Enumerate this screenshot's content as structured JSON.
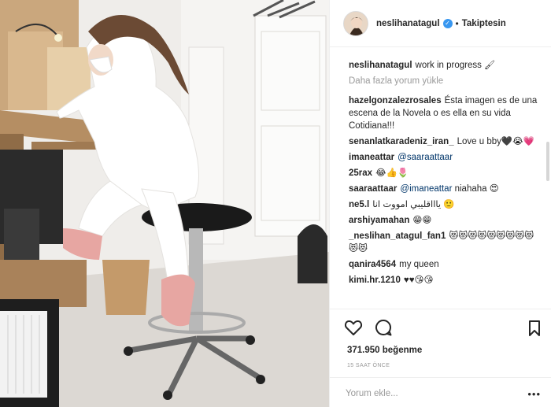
{
  "post": {
    "username": "neslihanatagul",
    "follow_status": "Takiptesin",
    "separator": "•",
    "verified_symbol": "✓"
  },
  "caption": {
    "username": "neslihanatagul",
    "text": "work in progress",
    "emoji": "🖌"
  },
  "load_more": "Daha fazla yorum yükle",
  "comments": [
    {
      "user": "hazelgonzalezrosales",
      "text": "Ésta imagen es de una escena de la Novela o es ella en su vida Cotidiana!!!"
    },
    {
      "user": "senanlatkaradeniz_iran_",
      "text": "Love u bby🖤😭💗"
    },
    {
      "user": "imaneattar",
      "mention": "@saaraattaar",
      "text": ""
    },
    {
      "user": "25rax",
      "text": "😂👍🌷"
    },
    {
      "user": "saaraattaar",
      "mention": "@imaneattar",
      "text": "niahaha 😍"
    },
    {
      "user": "ne5.l",
      "text": "ياااقليبي امووت انا 🙂"
    },
    {
      "user": "arshiyamahan",
      "text": "😁😁"
    },
    {
      "user": "_neslihan_atagul_fan1",
      "text": "😻😻😻😻😻😻😻😻😻😻😻"
    },
    {
      "user": "qanira4564",
      "text": "my queen"
    },
    {
      "user": "kimi.hr.1210",
      "text": "♥♥😘😘"
    }
  ],
  "actions": {
    "likes": "371.950 beğenme",
    "time": "15 SAAT ÖNCE"
  },
  "add_comment": {
    "placeholder": "Yorum ekle...",
    "more": "•••"
  },
  "colors": {
    "accent": "#3897f0",
    "text": "#262626",
    "muted": "#999999",
    "mention": "#003569",
    "border": "#efefef"
  },
  "icons": [
    "heart-icon",
    "comment-icon",
    "bookmark-icon",
    "verified-icon",
    "more-icon"
  ]
}
